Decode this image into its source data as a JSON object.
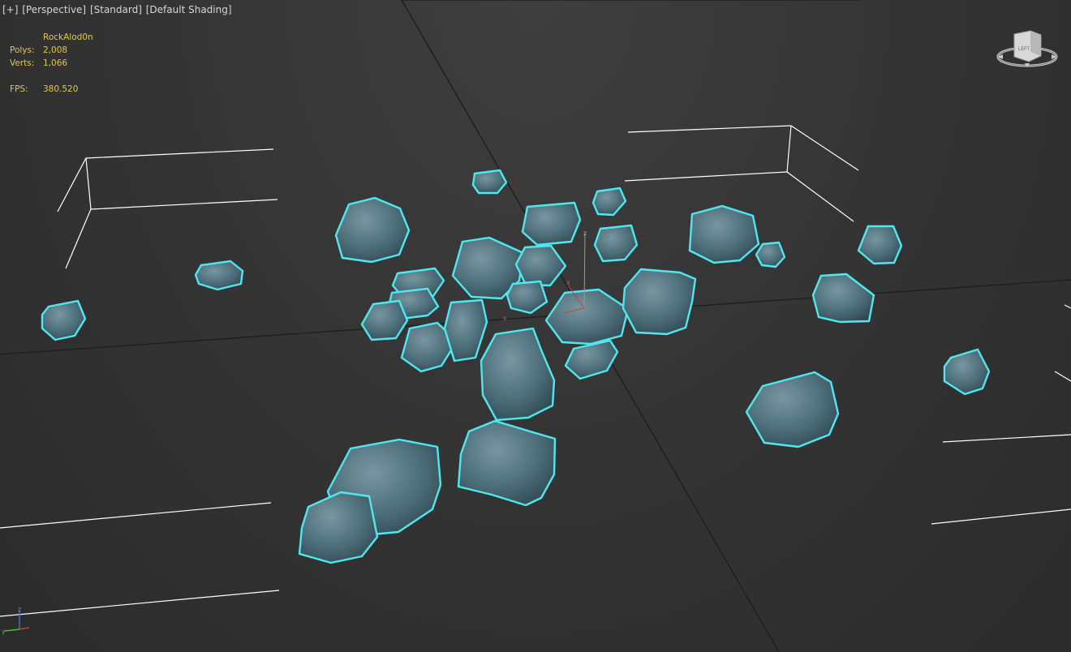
{
  "viewport": {
    "label_items": [
      "[+]",
      "[Perspective]",
      "[Standard]",
      "[Default Shading]"
    ]
  },
  "stats": {
    "object_name": "RockAlod0n",
    "polys_label": "Polys:",
    "polys_value": "2,008",
    "verts_label": "Verts:",
    "verts_value": "1,066",
    "fps_label": "FPS:",
    "fps_value": "380.520"
  },
  "viewcube": {
    "face_label": "LEFT"
  },
  "axis": {
    "z": "z",
    "x": "x",
    "y": "y"
  },
  "colors": {
    "background": "#333333",
    "grid_line": "#1d1d1d",
    "selection_outline": "#4fe8f0",
    "rock": "#4c6f7a",
    "stats_text": "#e3c84a",
    "box_lines": "#ffffff"
  }
}
